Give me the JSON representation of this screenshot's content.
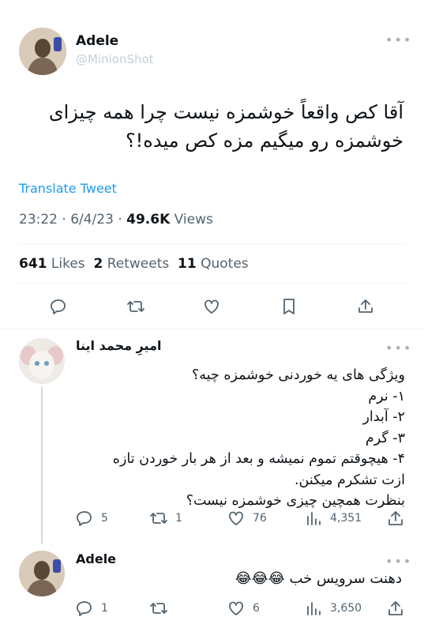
{
  "main_tweet": {
    "display_name": "Adele",
    "handle": "@MinionShot",
    "text_line1": "آقا کص واقعاً خوشمزه نیست چرا همه چیزای",
    "text_line2": "خوشمزه رو میگیم مزه کص میده!؟",
    "translate": "Translate Tweet",
    "time": "23:22 · 6/4/23 · ",
    "views_count": "49.6K",
    "views_label": " Views",
    "likes_count": "641",
    "likes_label": " Likes",
    "retweets_count": "2",
    "retweets_label": " Retweets",
    "quotes_count": "11",
    "quotes_label": " Quotes",
    "actions": [
      "reply-icon",
      "retweet-icon",
      "heart-icon",
      "bookmark-icon",
      "share-icon"
    ]
  },
  "reply1": {
    "display_name": "امیرِ محمد اینا",
    "lines": [
      "ویژگی های یه خوردنی خوشمزه چیه؟",
      "۱- نرم",
      "۲- آبدار",
      "۳- گرم",
      "۴- هیچوقتم تموم نمیشه و بعد از هر بار خوردن تازه",
      "ازت تشکرم میکنن.",
      "بنظرت همچین چیزی خوشمزه نیست؟"
    ],
    "replies": "5",
    "retweets": "1",
    "likes": "76",
    "views": "4,351"
  },
  "reply2": {
    "display_name": "Adele",
    "text": "دهنت سرویس خب",
    "emoji": "😂😂😂",
    "replies": "1",
    "retweets": "",
    "likes": "6",
    "views": "3,650"
  },
  "colors": {
    "link": "#1d9bf0",
    "text": "#0f1419",
    "secondary": "#536471"
  }
}
